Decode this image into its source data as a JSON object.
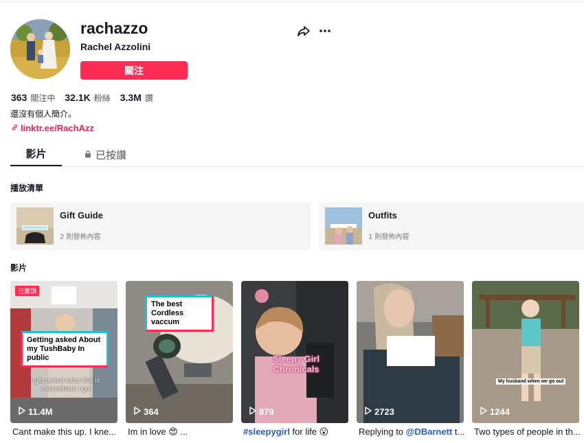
{
  "profile": {
    "username": "rachazzo",
    "nickname": "Rachel Azzolini",
    "follow_label": "關注",
    "bio": "還沒有個人簡介。",
    "link": "linktr.ee/RachAzz"
  },
  "stats": [
    {
      "value": "363",
      "label": "關注中"
    },
    {
      "value": "32.1K",
      "label": "粉絲"
    },
    {
      "value": "3.3M",
      "label": "讚"
    }
  ],
  "tabs": {
    "videos": "影片",
    "liked": "已按讚"
  },
  "sections": {
    "playlists_title": "播放清單",
    "videos_title": "影片"
  },
  "playlists": [
    {
      "name": "Gift Guide",
      "count": "2 則發佈內容"
    },
    {
      "name": "Outfits",
      "count": "1 則發佈內容"
    }
  ],
  "videos": [
    {
      "views": "11.4M",
      "caption": "Cant make this up. I kne...",
      "pinned": "已置頂",
      "overlay": "Getting asked About my TushBaby In public",
      "subtitle": "I get asked what this is everywhere I go"
    },
    {
      "views": "364",
      "caption_text": "Im in love 😍 ...",
      "overlay": "The best Cordless vaccum"
    },
    {
      "views": "879",
      "hashtag": "#sleepygirl",
      "caption_rest": " for life 😮",
      "overlay": "Sleepy Girl Chronicals"
    },
    {
      "views": "2723",
      "caption_pre": "Replying to ",
      "mention": "@DBarnett",
      "caption_post": " t..."
    },
    {
      "views": "1244",
      "caption": "Two types of people in th...",
      "overlay": "My husband when we go out"
    }
  ],
  "colors": {
    "accent": "#fe2c55",
    "text": "#161823",
    "link": "#2b5db9"
  }
}
